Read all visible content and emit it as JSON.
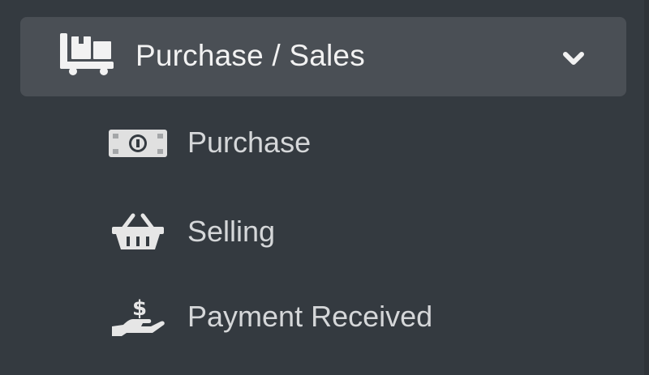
{
  "menu": {
    "header": {
      "label": "Purchase / Sales",
      "icon": "dolly-icon",
      "expanded": true
    },
    "items": [
      {
        "label": "Purchase",
        "icon": "money-bill-icon"
      },
      {
        "label": "Selling",
        "icon": "shopping-basket-icon"
      },
      {
        "label": "Payment Received",
        "icon": "hand-holding-usd-icon"
      }
    ]
  },
  "colors": {
    "sidebar_bg": "#343a40",
    "header_bg": "#4a4f55",
    "header_text": "#f2f2f2",
    "item_text": "#d5d7d9",
    "icon": "#e6e6e6"
  }
}
